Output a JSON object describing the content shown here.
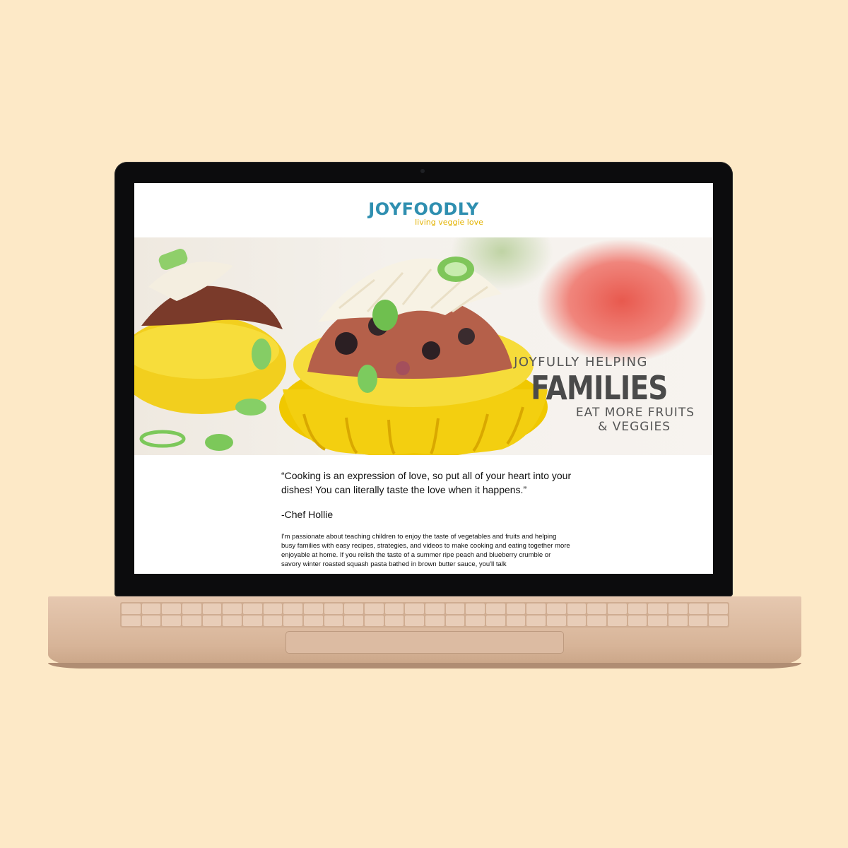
{
  "site": {
    "logo": "JOYFOODLY",
    "tagline": "living veggie love"
  },
  "hero": {
    "line1": "JOYFULLY HELPING",
    "line2": "FAMILIES",
    "line3": "EAT MORE FRUITS",
    "line4": "& VEGGIES"
  },
  "content": {
    "quote": "“Cooking is an expression of love, so put all of your heart into your dishes! You can literally taste the love when it happens.”",
    "author": "-Chef Hollie",
    "bio": "I'm passionate about teaching children to enjoy the taste of vegetables and fruits and helping busy families with easy recipes, strategies, and videos to make cooking and eating together more enjoyable at home. If you relish the taste of a summer ripe peach and blueberry crumble or savory winter roasted squash pasta bathed in brown butter sauce, you'll talk"
  },
  "colors": {
    "background": "#fde9c7",
    "logo": "#2f8fb0",
    "tagline": "#e3b200",
    "laptop_body": "#d7b498"
  }
}
